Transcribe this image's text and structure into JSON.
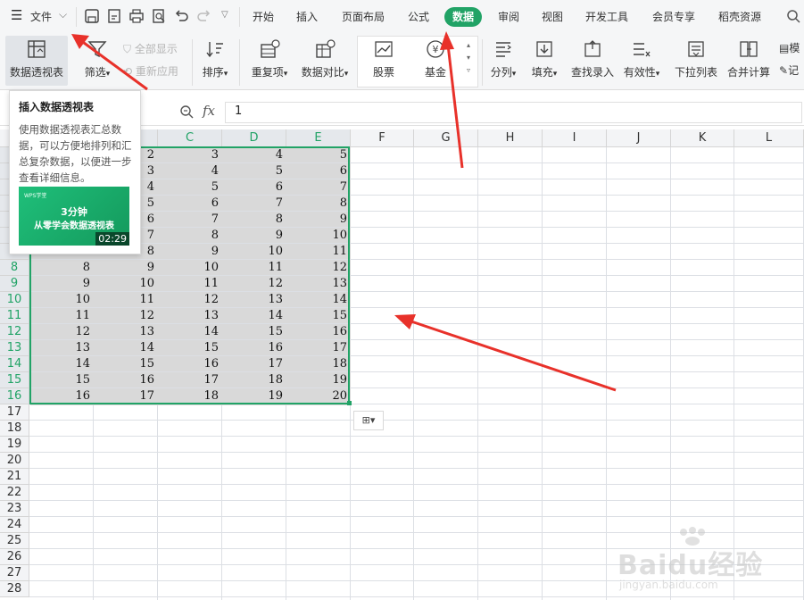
{
  "menubar": {
    "file_label": "文件",
    "tabs": [
      "开始",
      "插入",
      "页面布局",
      "公式",
      "数据",
      "审阅",
      "视图",
      "开发工具",
      "会员专享",
      "稻壳资源"
    ],
    "active_tab": "数据"
  },
  "ribbon": {
    "pivot_label": "数据透视表",
    "filter_label": "筛选",
    "show_all_label": "全部显示",
    "reapply_label": "重新应用",
    "sort_label": "排序",
    "duplicates_label": "重复项",
    "compare_label": "数据对比",
    "stocks_label": "股票",
    "fund_label": "基金",
    "split_label": "分列",
    "fill_label": "填充",
    "lookup_label": "查找录入",
    "validity_label": "有效性",
    "dropdown_label": "下拉列表",
    "merge_calc_label": "合并计算",
    "more1_label": "模",
    "more2_label": "记"
  },
  "tooltip": {
    "title": "插入数据透视表",
    "body": "使用数据透视表汇总数据，可以方便地排列和汇总复杂数据，以便进一步查看详细信息。",
    "video_line1": "3分钟",
    "video_line2": "从零学会数据透视表",
    "video_duration": "02:29",
    "video_brand": "WPS学堂"
  },
  "formula_bar": {
    "fx_label": "fx",
    "value": "1"
  },
  "sheet": {
    "columns": [
      "C",
      "D",
      "E",
      "F",
      "G",
      "H",
      "I",
      "J",
      "K",
      "L"
    ],
    "selected_columns": [
      "C",
      "D",
      "E"
    ],
    "row_numbers": [
      "8",
      "9",
      "10",
      "11",
      "12",
      "13",
      "14",
      "15",
      "16",
      "17",
      "18",
      "19",
      "20",
      "21",
      "22",
      "23",
      "24",
      "25",
      "26",
      "27",
      "28"
    ],
    "selected_rows": [
      "8",
      "9",
      "10",
      "11",
      "12",
      "13",
      "14",
      "15",
      "16"
    ],
    "rows": [
      [
        "",
        "2",
        "3",
        "4",
        "5"
      ],
      [
        "",
        "3",
        "4",
        "5",
        "6"
      ],
      [
        "",
        "4",
        "5",
        "6",
        "7"
      ],
      [
        "",
        "5",
        "6",
        "7",
        "8"
      ],
      [
        "",
        "6",
        "7",
        "8",
        "9"
      ],
      [
        "",
        "7",
        "8",
        "9",
        "10"
      ],
      [
        "7",
        "8",
        "9",
        "10",
        "11"
      ],
      [
        "8",
        "9",
        "10",
        "11",
        "12"
      ],
      [
        "9",
        "10",
        "11",
        "12",
        "13"
      ],
      [
        "10",
        "11",
        "12",
        "13",
        "14"
      ],
      [
        "11",
        "12",
        "13",
        "14",
        "15"
      ],
      [
        "12",
        "13",
        "14",
        "15",
        "16"
      ],
      [
        "13",
        "14",
        "15",
        "16",
        "17"
      ],
      [
        "14",
        "15",
        "16",
        "17",
        "18"
      ],
      [
        "15",
        "16",
        "17",
        "18",
        "19"
      ],
      [
        "16",
        "17",
        "18",
        "19",
        "20"
      ]
    ]
  },
  "watermark": {
    "logo_text": "Baidu经验",
    "url_text": "jingyan.baidu.com"
  },
  "colors": {
    "accent": "#21a366",
    "selection_fill": "#d9d9d9",
    "arrow": "#e8312a"
  }
}
